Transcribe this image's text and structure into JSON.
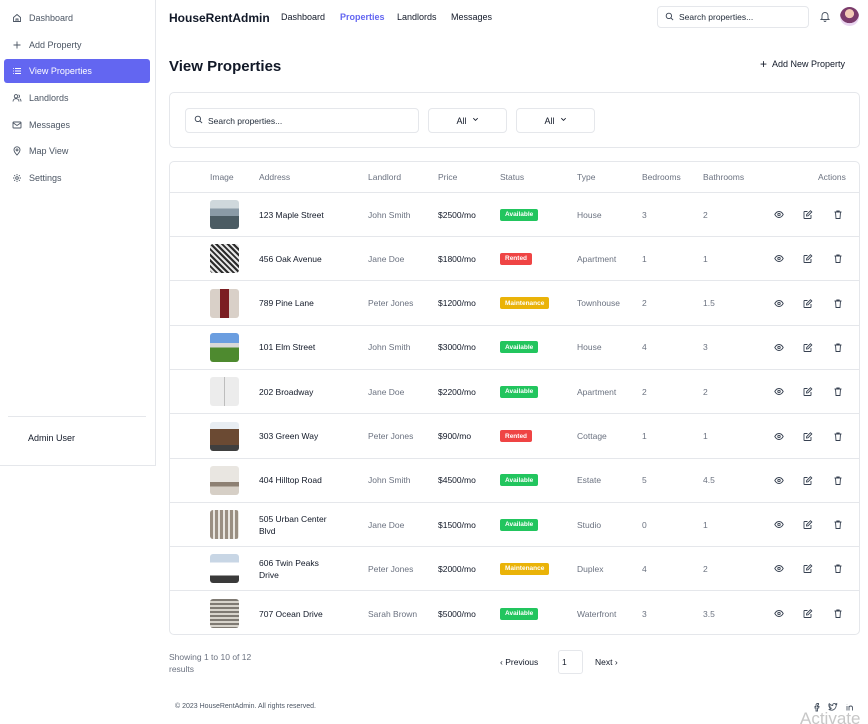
{
  "app": {
    "brand": "HouseRentAdmin"
  },
  "sidebar": {
    "items": [
      {
        "label": "Dashboard",
        "icon": "home-icon"
      },
      {
        "label": "Add Property",
        "icon": "plus-icon"
      },
      {
        "label": "View Properties",
        "icon": "list-icon",
        "active": true
      },
      {
        "label": "Landlords",
        "icon": "users-icon"
      },
      {
        "label": "Messages",
        "icon": "mail-icon"
      },
      {
        "label": "Map View",
        "icon": "map-pin-icon"
      },
      {
        "label": "Settings",
        "icon": "gear-icon"
      }
    ],
    "user": "Admin User"
  },
  "topnav": {
    "links": [
      "Dashboard",
      "Properties",
      "Landlords",
      "Messages"
    ],
    "active": "Properties",
    "search_placeholder": "Search properties..."
  },
  "page": {
    "title": "View Properties",
    "add_button": "Add New Property"
  },
  "filters": {
    "search_placeholder": "Search properties...",
    "status_select": "All",
    "type_select": "All"
  },
  "table": {
    "headers": [
      "Image",
      "Address",
      "Landlord",
      "Price",
      "Status",
      "Type",
      "Bedrooms",
      "Bathrooms",
      "Actions"
    ],
    "rows": [
      {
        "address": "123 Maple Street",
        "landlord": "John Smith",
        "price": "$2500/mo",
        "status": "Available",
        "type": "House",
        "bedrooms": "3",
        "bathrooms": "2"
      },
      {
        "address": "456 Oak Avenue",
        "landlord": "Jane Doe",
        "price": "$1800/mo",
        "status": "Rented",
        "type": "Apartment",
        "bedrooms": "1",
        "bathrooms": "1"
      },
      {
        "address": "789 Pine Lane",
        "landlord": "Peter Jones",
        "price": "$1200/mo",
        "status": "Maintenance",
        "type": "Townhouse",
        "bedrooms": "2",
        "bathrooms": "1.5"
      },
      {
        "address": "101 Elm Street",
        "landlord": "John Smith",
        "price": "$3000/mo",
        "status": "Available",
        "type": "House",
        "bedrooms": "4",
        "bathrooms": "3"
      },
      {
        "address": "202 Broadway",
        "landlord": "Jane Doe",
        "price": "$2200/mo",
        "status": "Available",
        "type": "Apartment",
        "bedrooms": "2",
        "bathrooms": "2"
      },
      {
        "address": "303 Green Way",
        "landlord": "Peter Jones",
        "price": "$900/mo",
        "status": "Rented",
        "type": "Cottage",
        "bedrooms": "1",
        "bathrooms": "1"
      },
      {
        "address": "404 Hilltop Road",
        "landlord": "John Smith",
        "price": "$4500/mo",
        "status": "Available",
        "type": "Estate",
        "bedrooms": "5",
        "bathrooms": "4.5"
      },
      {
        "address": "505 Urban Center Blvd",
        "landlord": "Jane Doe",
        "price": "$1500/mo",
        "status": "Available",
        "type": "Studio",
        "bedrooms": "0",
        "bathrooms": "1"
      },
      {
        "address": "606 Twin Peaks Drive",
        "landlord": "Peter Jones",
        "price": "$2000/mo",
        "status": "Maintenance",
        "type": "Duplex",
        "bedrooms": "4",
        "bathrooms": "2"
      },
      {
        "address": "707 Ocean Drive",
        "landlord": "Sarah Brown",
        "price": "$5000/mo",
        "status": "Available",
        "type": "Waterfront",
        "bedrooms": "3",
        "bathrooms": "3.5"
      }
    ]
  },
  "status_colors": {
    "Available": "#22c55e",
    "Rented": "#ef4444",
    "Maintenance": "#eab308"
  },
  "accent_color": "#6366f1",
  "pagination": {
    "showing": "Showing 1 to 10 of 12 results",
    "prev": "Previous",
    "page": "1",
    "next": "Next"
  },
  "footer": {
    "copyright": "© 2023 HouseRentAdmin. All rights reserved.",
    "social": [
      "facebook-icon",
      "twitter-icon",
      "linkedin-icon"
    ]
  },
  "watermark": "Activate"
}
